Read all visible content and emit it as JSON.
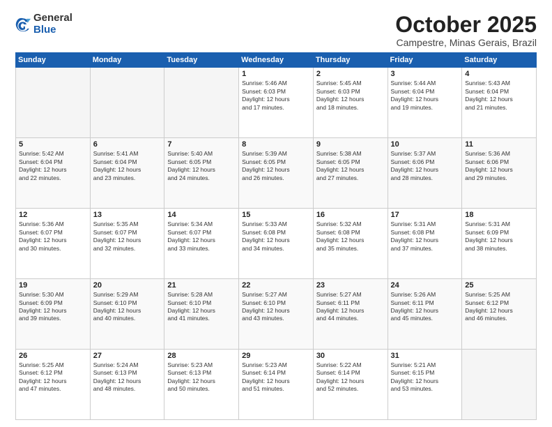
{
  "logo": {
    "general": "General",
    "blue": "Blue"
  },
  "header": {
    "month": "October 2025",
    "location": "Campestre, Minas Gerais, Brazil"
  },
  "weekdays": [
    "Sunday",
    "Monday",
    "Tuesday",
    "Wednesday",
    "Thursday",
    "Friday",
    "Saturday"
  ],
  "weeks": [
    [
      {
        "day": "",
        "info": ""
      },
      {
        "day": "",
        "info": ""
      },
      {
        "day": "",
        "info": ""
      },
      {
        "day": "1",
        "info": "Sunrise: 5:46 AM\nSunset: 6:03 PM\nDaylight: 12 hours\nand 17 minutes."
      },
      {
        "day": "2",
        "info": "Sunrise: 5:45 AM\nSunset: 6:03 PM\nDaylight: 12 hours\nand 18 minutes."
      },
      {
        "day": "3",
        "info": "Sunrise: 5:44 AM\nSunset: 6:04 PM\nDaylight: 12 hours\nand 19 minutes."
      },
      {
        "day": "4",
        "info": "Sunrise: 5:43 AM\nSunset: 6:04 PM\nDaylight: 12 hours\nand 21 minutes."
      }
    ],
    [
      {
        "day": "5",
        "info": "Sunrise: 5:42 AM\nSunset: 6:04 PM\nDaylight: 12 hours\nand 22 minutes."
      },
      {
        "day": "6",
        "info": "Sunrise: 5:41 AM\nSunset: 6:04 PM\nDaylight: 12 hours\nand 23 minutes."
      },
      {
        "day": "7",
        "info": "Sunrise: 5:40 AM\nSunset: 6:05 PM\nDaylight: 12 hours\nand 24 minutes."
      },
      {
        "day": "8",
        "info": "Sunrise: 5:39 AM\nSunset: 6:05 PM\nDaylight: 12 hours\nand 26 minutes."
      },
      {
        "day": "9",
        "info": "Sunrise: 5:38 AM\nSunset: 6:05 PM\nDaylight: 12 hours\nand 27 minutes."
      },
      {
        "day": "10",
        "info": "Sunrise: 5:37 AM\nSunset: 6:06 PM\nDaylight: 12 hours\nand 28 minutes."
      },
      {
        "day": "11",
        "info": "Sunrise: 5:36 AM\nSunset: 6:06 PM\nDaylight: 12 hours\nand 29 minutes."
      }
    ],
    [
      {
        "day": "12",
        "info": "Sunrise: 5:36 AM\nSunset: 6:07 PM\nDaylight: 12 hours\nand 30 minutes."
      },
      {
        "day": "13",
        "info": "Sunrise: 5:35 AM\nSunset: 6:07 PM\nDaylight: 12 hours\nand 32 minutes."
      },
      {
        "day": "14",
        "info": "Sunrise: 5:34 AM\nSunset: 6:07 PM\nDaylight: 12 hours\nand 33 minutes."
      },
      {
        "day": "15",
        "info": "Sunrise: 5:33 AM\nSunset: 6:08 PM\nDaylight: 12 hours\nand 34 minutes."
      },
      {
        "day": "16",
        "info": "Sunrise: 5:32 AM\nSunset: 6:08 PM\nDaylight: 12 hours\nand 35 minutes."
      },
      {
        "day": "17",
        "info": "Sunrise: 5:31 AM\nSunset: 6:08 PM\nDaylight: 12 hours\nand 37 minutes."
      },
      {
        "day": "18",
        "info": "Sunrise: 5:31 AM\nSunset: 6:09 PM\nDaylight: 12 hours\nand 38 minutes."
      }
    ],
    [
      {
        "day": "19",
        "info": "Sunrise: 5:30 AM\nSunset: 6:09 PM\nDaylight: 12 hours\nand 39 minutes."
      },
      {
        "day": "20",
        "info": "Sunrise: 5:29 AM\nSunset: 6:10 PM\nDaylight: 12 hours\nand 40 minutes."
      },
      {
        "day": "21",
        "info": "Sunrise: 5:28 AM\nSunset: 6:10 PM\nDaylight: 12 hours\nand 41 minutes."
      },
      {
        "day": "22",
        "info": "Sunrise: 5:27 AM\nSunset: 6:10 PM\nDaylight: 12 hours\nand 43 minutes."
      },
      {
        "day": "23",
        "info": "Sunrise: 5:27 AM\nSunset: 6:11 PM\nDaylight: 12 hours\nand 44 minutes."
      },
      {
        "day": "24",
        "info": "Sunrise: 5:26 AM\nSunset: 6:11 PM\nDaylight: 12 hours\nand 45 minutes."
      },
      {
        "day": "25",
        "info": "Sunrise: 5:25 AM\nSunset: 6:12 PM\nDaylight: 12 hours\nand 46 minutes."
      }
    ],
    [
      {
        "day": "26",
        "info": "Sunrise: 5:25 AM\nSunset: 6:12 PM\nDaylight: 12 hours\nand 47 minutes."
      },
      {
        "day": "27",
        "info": "Sunrise: 5:24 AM\nSunset: 6:13 PM\nDaylight: 12 hours\nand 48 minutes."
      },
      {
        "day": "28",
        "info": "Sunrise: 5:23 AM\nSunset: 6:13 PM\nDaylight: 12 hours\nand 50 minutes."
      },
      {
        "day": "29",
        "info": "Sunrise: 5:23 AM\nSunset: 6:14 PM\nDaylight: 12 hours\nand 51 minutes."
      },
      {
        "day": "30",
        "info": "Sunrise: 5:22 AM\nSunset: 6:14 PM\nDaylight: 12 hours\nand 52 minutes."
      },
      {
        "day": "31",
        "info": "Sunrise: 5:21 AM\nSunset: 6:15 PM\nDaylight: 12 hours\nand 53 minutes."
      },
      {
        "day": "",
        "info": ""
      }
    ]
  ]
}
